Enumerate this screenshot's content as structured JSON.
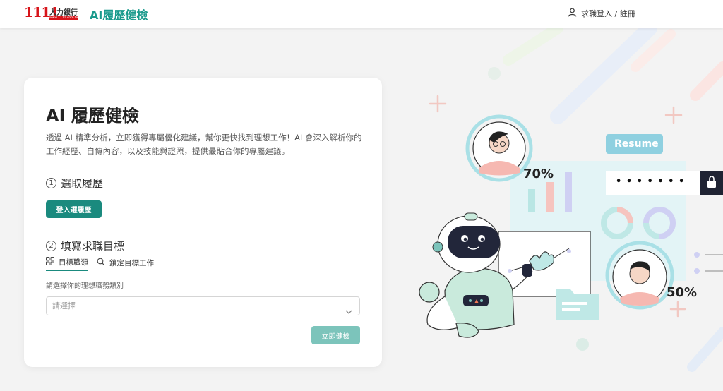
{
  "header": {
    "logo_number": "1111",
    "logo_text": "人力銀行",
    "logo_url": "www.1111.com.tw",
    "brand_title": "AI履歷健檢",
    "login_label": "求職登入 / 註冊"
  },
  "card": {
    "title": "AI 履歷健檢",
    "description": "透過 AI 精準分析，立即獲得專屬優化建議，幫你更快找到理想工作！AI 會深入解析你的工作經歷、自傳內容，以及技能與證照，提供最貼合你的專屬建議。",
    "step1": {
      "num": "1",
      "label": "選取履歷",
      "button": "登入選履歷"
    },
    "step2": {
      "num": "2",
      "label": "填寫求職目標",
      "tabs": [
        {
          "label": "目標職類",
          "active": true
        },
        {
          "label": "鎖定目標工作",
          "active": false
        }
      ],
      "hint": "請選擇你的理想職務類別",
      "select_placeholder": "請選擇",
      "submit": "立即健檢"
    }
  },
  "illustration": {
    "resume_tag": "Resume",
    "password_mask": "• • • • • • •",
    "percent_top": "70%",
    "percent_bottom": "50%"
  },
  "colors": {
    "brand_red": "#d7141a",
    "brand_teal": "#1a9a8c",
    "button_teal": "#1a8a7e",
    "button_disabled": "#7cc4bb"
  }
}
